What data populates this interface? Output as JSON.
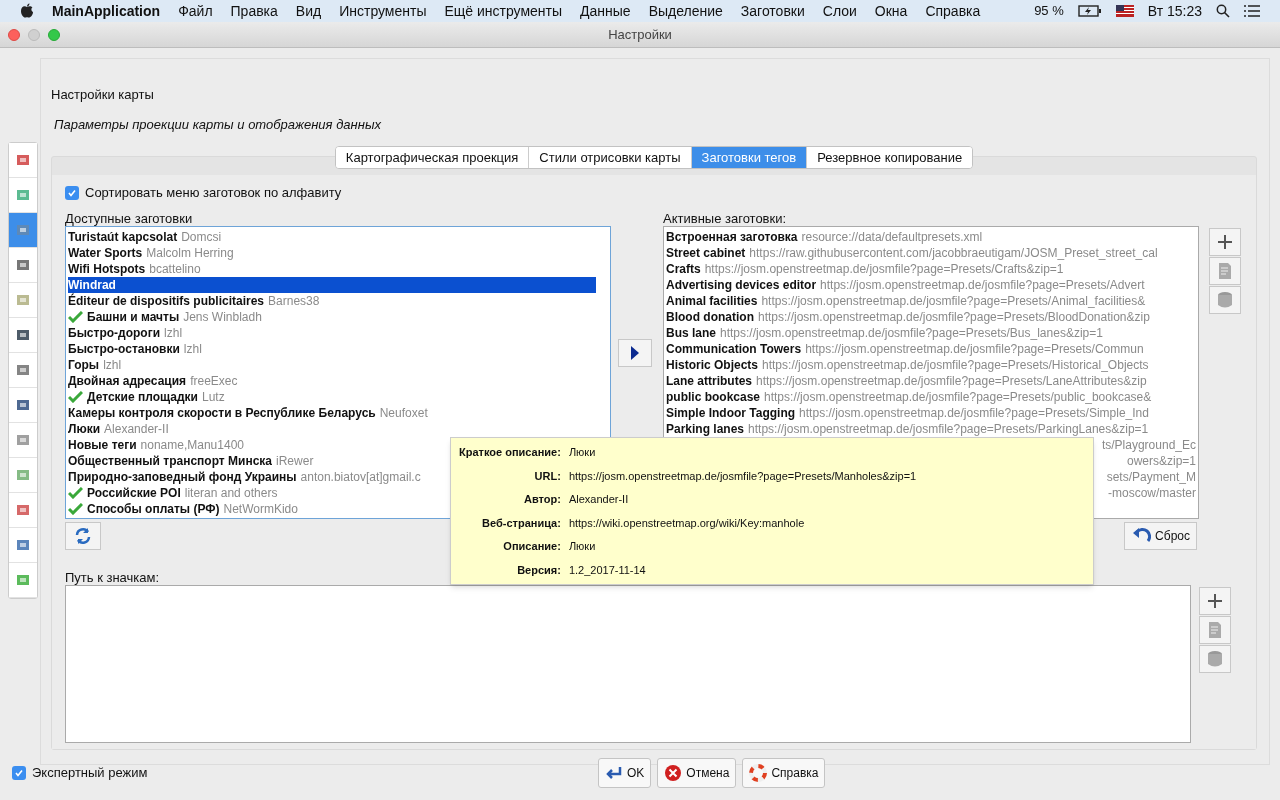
{
  "menubar": {
    "app": "MainApplication",
    "items": [
      "Файл",
      "Правка",
      "Вид",
      "Инструменты",
      "Ещё инструменты",
      "Данные",
      "Выделение",
      "Заготовки",
      "Слои",
      "Окна",
      "Справка"
    ],
    "battery": "95 %",
    "clock": "Вт 15:23"
  },
  "window": {
    "title": "Настройки"
  },
  "sidebar": {
    "items": [
      {
        "selected": false
      },
      {
        "selected": false
      },
      {
        "selected": true
      },
      {
        "selected": false
      },
      {
        "selected": false
      },
      {
        "selected": false
      },
      {
        "selected": false
      },
      {
        "selected": false
      },
      {
        "selected": false
      },
      {
        "selected": false
      },
      {
        "selected": false
      },
      {
        "selected": false
      },
      {
        "selected": false
      }
    ]
  },
  "header": {
    "title": "Настройки карты",
    "subtitle": "Параметры проекции карты и отображения данных"
  },
  "tabs": [
    {
      "label": "Картографическая проекция",
      "selected": false
    },
    {
      "label": "Стили отрисовки карты",
      "selected": false
    },
    {
      "label": "Заготовки тегов",
      "selected": true
    },
    {
      "label": "Резервное копирование",
      "selected": false
    }
  ],
  "sort_checkbox": {
    "label": "Сортировать меню заготовок по алфавиту",
    "checked": true
  },
  "available": {
    "label": "Доступные заготовки",
    "items": [
      {
        "name": "Turistaút kapcsolat",
        "author": "Domcsi",
        "installed": false,
        "selected": false
      },
      {
        "name": "Water Sports",
        "author": "Malcolm Herring",
        "installed": false,
        "selected": false
      },
      {
        "name": "Wifi Hotspots",
        "author": "bcattelino",
        "installed": false,
        "selected": false
      },
      {
        "name": "Windrad",
        "installed": false,
        "selected": true
      },
      {
        "name": "Éditeur de dispositifs publicitaires",
        "author": "Barnes38",
        "installed": false,
        "selected": false
      },
      {
        "name": "Башни и мачты",
        "author": "Jens Winbladh",
        "installed": true,
        "selected": false
      },
      {
        "name": "Быстро-дороги",
        "author": "lzhl",
        "installed": false,
        "selected": false
      },
      {
        "name": "Быстро-остановки",
        "author": "lzhl",
        "installed": false,
        "selected": false
      },
      {
        "name": "Горы",
        "author": "lzhl",
        "installed": false,
        "selected": false
      },
      {
        "name": "Двойная адресация",
        "author": "freeExec",
        "installed": false,
        "selected": false
      },
      {
        "name": "Детские площадки",
        "author": "Lutz",
        "installed": true,
        "selected": false
      },
      {
        "name": "Камеры контроля скорости в Республике Беларусь",
        "author": "Neufoxet",
        "installed": false,
        "selected": false
      },
      {
        "name": "Люки",
        "author": "Alexander-II",
        "installed": false,
        "selected": false
      },
      {
        "name": "Новые теги",
        "author": "noname,Manu1400",
        "installed": false,
        "selected": false
      },
      {
        "name": "Общественный транспорт Минска",
        "author": "iRewer",
        "installed": false,
        "selected": false
      },
      {
        "name": "Природно-заповедный фонд Украины",
        "author": "anton.biatov[at]gmail.c",
        "installed": false,
        "selected": false
      },
      {
        "name": "Российские POI",
        "author": "literan and others",
        "installed": true,
        "selected": false
      },
      {
        "name": "Способы оплаты (РФ)",
        "author": "NetWormKido",
        "installed": true,
        "selected": false
      }
    ]
  },
  "active": {
    "label": "Активные заготовки:",
    "items": [
      {
        "name": "Встроенная заготовка",
        "source": "resource://data/defaultpresets.xml"
      },
      {
        "name": "Street cabinet",
        "source": "https://raw.githubusercontent.com/jacobbraeutigam/JOSM_Preset_street_cal"
      },
      {
        "name": "Crafts",
        "source": "https://josm.openstreetmap.de/josmfile?page=Presets/Crafts&zip=1"
      },
      {
        "name": "Advertising devices editor",
        "source": "https://josm.openstreetmap.de/josmfile?page=Presets/Advert"
      },
      {
        "name": "Animal facilities",
        "source": "https://josm.openstreetmap.de/josmfile?page=Presets/Animal_facilities&"
      },
      {
        "name": "Blood donation",
        "source": "https://josm.openstreetmap.de/josmfile?page=Presets/BloodDonation&zip"
      },
      {
        "name": "Bus lane",
        "source": "https://josm.openstreetmap.de/josmfile?page=Presets/Bus_lanes&zip=1"
      },
      {
        "name": "Communication Towers",
        "source": "https://josm.openstreetmap.de/josmfile?page=Presets/Commun"
      },
      {
        "name": "Historic Objects",
        "source": "https://josm.openstreetmap.de/josmfile?page=Presets/Historical_Objects"
      },
      {
        "name": "Lane attributes",
        "source": "https://josm.openstreetmap.de/josmfile?page=Presets/LaneAttributes&zip"
      },
      {
        "name": "public bookcase",
        "source": "https://josm.openstreetmap.de/josmfile?page=Presets/public_bookcase&"
      },
      {
        "name": "Simple Indoor Tagging",
        "source": "https://josm.openstreetmap.de/josmfile?page=Presets/Simple_Ind"
      },
      {
        "name": "Parking lanes",
        "source": "https://josm.openstreetmap.de/josmfile?page=Presets/ParkingLanes&zip=1"
      },
      {
        "source": "ts/Playground_Ec"
      },
      {
        "source": "owers&zip=1"
      },
      {
        "source": "sets/Payment_M"
      },
      {
        "source": "-moscow/master"
      }
    ]
  },
  "reset_button": {
    "label": "Сброс"
  },
  "tooltip": {
    "rows": [
      {
        "key": "Краткое описание:",
        "value": "Люки"
      },
      {
        "key": "URL:",
        "value": "https://josm.openstreetmap.de/josmfile?page=Presets/Manholes&zip=1"
      },
      {
        "key": "Автор:",
        "value": "Alexander-II"
      },
      {
        "key": "Веб-страница:",
        "value": "https://wiki.openstreetmap.org/wiki/Key:manhole"
      },
      {
        "key": "Описание:",
        "value": "Люки"
      },
      {
        "key": "Версия:",
        "value": "1.2_2017-11-14"
      }
    ]
  },
  "icon_paths": {
    "label": "Путь к значкам:"
  },
  "expert_checkbox": {
    "label": "Экспертный режим",
    "checked": true
  },
  "buttons": [
    {
      "kind": "ok",
      "label": "OK"
    },
    {
      "kind": "cancel",
      "label": "Отмена"
    },
    {
      "kind": "help",
      "label": "Справка"
    }
  ]
}
